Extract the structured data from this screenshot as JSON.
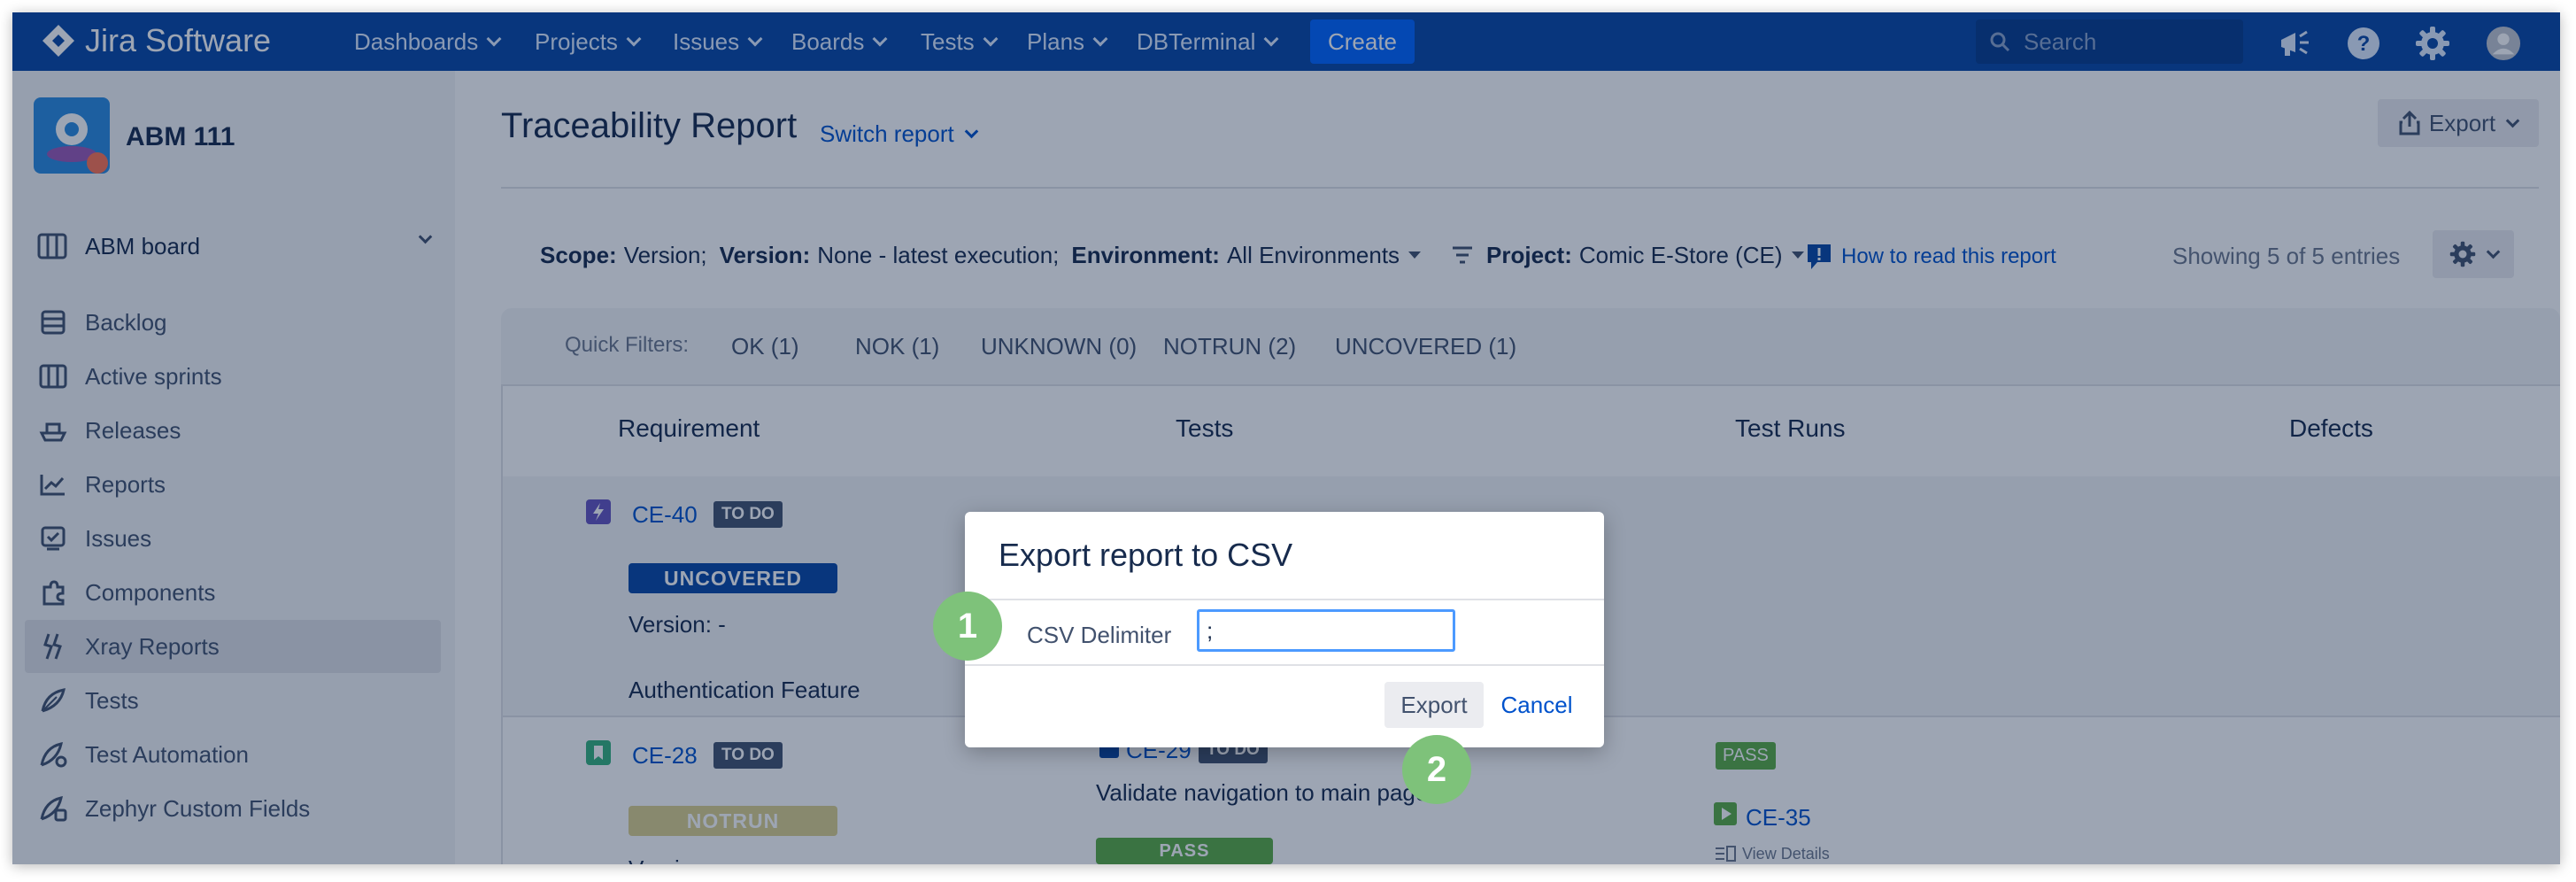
{
  "app": {
    "name": "Jira Software"
  },
  "topnav": {
    "items": [
      "Dashboards",
      "Projects",
      "Issues",
      "Boards",
      "Tests",
      "Plans",
      "DBTerminal"
    ],
    "create_label": "Create",
    "search_placeholder": "Search"
  },
  "sidebar": {
    "project_name": "ABM 111",
    "board_label": "ABM board",
    "items": [
      {
        "label": "Backlog",
        "icon": "backlog-icon"
      },
      {
        "label": "Active sprints",
        "icon": "board-icon"
      },
      {
        "label": "Releases",
        "icon": "ship-icon"
      },
      {
        "label": "Reports",
        "icon": "reports-icon"
      },
      {
        "label": "Issues",
        "icon": "issues-icon"
      },
      {
        "label": "Components",
        "icon": "puzzle-icon"
      },
      {
        "label": "Xray Reports",
        "icon": "xray-icon",
        "active": true
      },
      {
        "label": "Tests",
        "icon": "feather-icon"
      },
      {
        "label": "Test Automation",
        "icon": "automation-icon"
      },
      {
        "label": "Zephyr Custom Fields",
        "icon": "zephyr-icon"
      }
    ]
  },
  "report": {
    "title": "Traceability Report",
    "switch_label": "Switch report",
    "export_label": "Export",
    "scope_key": "Scope:",
    "scope_value": "Version;",
    "version_key": "Version:",
    "version_value": "None - latest execution;",
    "env_key": "Environment:",
    "env_value": "All Environments",
    "project_key": "Project:",
    "project_value": "Comic E-Store (CE)",
    "how_to_read": "How to read this report",
    "showing": "Showing 5 of 5 entries"
  },
  "quick_filters": {
    "label": "Quick Filters:",
    "items": [
      "OK (1)",
      "NOK (1)",
      "UNKNOWN (0)",
      "NOTRUN (2)",
      "UNCOVERED (1)"
    ]
  },
  "table": {
    "headers": [
      "Requirement",
      "Tests",
      "Test Runs",
      "Defects"
    ],
    "row1": {
      "key": "CE-40",
      "status": "TO DO",
      "coverage": "UNCOVERED",
      "version": "Version: -",
      "summary": "Authentication Feature"
    },
    "row2": {
      "key": "CE-28",
      "status": "TO DO",
      "coverage": "NOTRUN",
      "version": "Version: -",
      "test_key": "CE-29",
      "test_status": "TO DO",
      "test_summary": "Validate navigation to main page",
      "test_result": "PASS",
      "run_result": "PASS",
      "run_key": "CE-35",
      "view_details": "View Details"
    }
  },
  "dialog": {
    "title": "Export report to CSV",
    "delimiter_label": "CSV Delimiter",
    "delimiter_value": ";",
    "export_label": "Export",
    "cancel_label": "Cancel"
  },
  "callouts": [
    "1",
    "2"
  ],
  "colors": {
    "nav": "#0747a6",
    "accent": "#0052cc",
    "callout": "#7ec27a",
    "uncovered": "#0747a6",
    "notrun": "#ddd08c",
    "pass": "#5aac44"
  }
}
